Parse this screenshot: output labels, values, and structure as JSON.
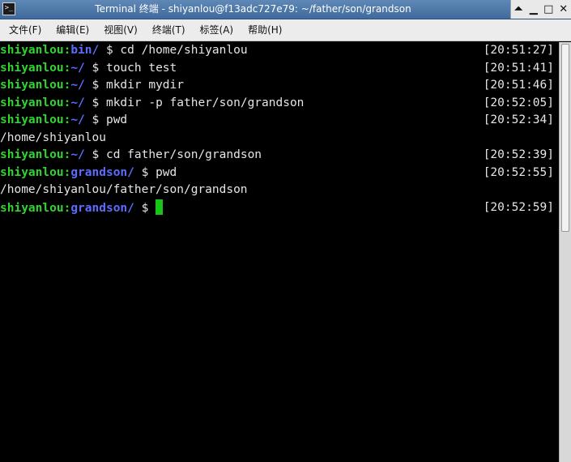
{
  "window": {
    "title": "Terminal 终端 - shiyanlou@f13adc727e79: ~/father/son/grandson",
    "app_icon": ">_",
    "controls": {
      "shade": "⏶",
      "minimize": "▁",
      "maximize": "□",
      "close": "✕"
    }
  },
  "menubar": {
    "items": [
      {
        "label": "文件(F)"
      },
      {
        "label": "编辑(E)"
      },
      {
        "label": "视图(V)"
      },
      {
        "label": "终端(T)"
      },
      {
        "label": "标签(A)"
      },
      {
        "label": "帮助(H)"
      }
    ]
  },
  "terminal": {
    "lines": [
      {
        "user": "shiyanlou",
        "sep": ":",
        "dir": "bin/",
        "cmd": " $ cd /home/shiyanlou",
        "time": "[20:51:27]"
      },
      {
        "user": "shiyanlou",
        "sep": ":",
        "dir": "~/",
        "cmd": " $ touch test",
        "time": "[20:51:41]"
      },
      {
        "user": "shiyanlou",
        "sep": ":",
        "dir": "~/",
        "cmd": " $ mkdir mydir",
        "time": "[20:51:46]"
      },
      {
        "user": "shiyanlou",
        "sep": ":",
        "dir": "~/",
        "cmd": " $ mkdir -p father/son/grandson",
        "time": "[20:52:05]"
      },
      {
        "user": "shiyanlou",
        "sep": ":",
        "dir": "~/",
        "cmd": " $ pwd",
        "time": "[20:52:34]"
      },
      {
        "output": "/home/shiyanlou"
      },
      {
        "user": "shiyanlou",
        "sep": ":",
        "dir": "~/",
        "cmd": " $ cd father/son/grandson",
        "time": "[20:52:39]"
      },
      {
        "user": "shiyanlou",
        "sep": ":",
        "dir": "grandson/",
        "cmd": " $ pwd",
        "time": "[20:52:55]"
      },
      {
        "output": "/home/shiyanlou/father/son/grandson"
      },
      {
        "user": "shiyanlou",
        "sep": ":",
        "dir": "grandson/",
        "cmd": " $ ",
        "time": "[20:52:59]",
        "cursor": true
      }
    ]
  },
  "colors": {
    "user": "#2fd42f",
    "dir": "#5b6cff",
    "text": "#e5e5e5",
    "background": "#000000",
    "cursor": "#19c419"
  }
}
